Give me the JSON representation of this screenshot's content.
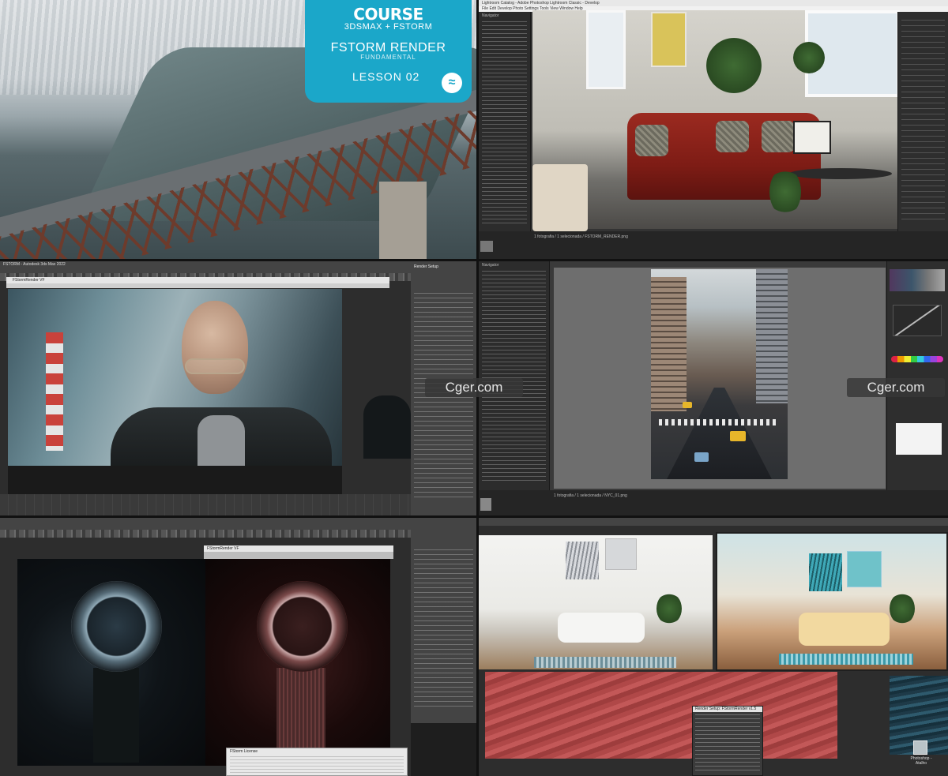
{
  "course_card": {
    "title": "COURSE",
    "subtitle": "3DSMAX + FSTORM",
    "name": "FSTORM RENDER",
    "tagline": "FUNDAMENTAL",
    "lesson": "LESSON 02"
  },
  "watermark": "Cger.com",
  "lightroom_top": {
    "title": "Lightroom Catalog - Adobe Photoshop Lightroom Classic - Develop",
    "menu": "File  Edit  Develop  Photo  Settings  Tools  View  Window  Help",
    "status": "1 fotografia / 1 selecionada / FSTORM_RENDER.png",
    "left_panel_label": "Navigator"
  },
  "max_middle": {
    "title": "FSTORM - Autodesk 3ds Max 2022",
    "framebuffer_title": "FStormRender VF",
    "render_setup_label": "Render Setup"
  },
  "lightroom_middle": {
    "status": "1 fotografia / 1 selecionada / NYC_01.png",
    "left_panel_label": "Navigator"
  },
  "max_bottom": {
    "framebuffer_title": "FStormRender VF",
    "license_title": "FStorm License"
  },
  "interior_bottom": {
    "dialog_title": "Render Setup: FStormRender v1.5",
    "desktop_icon_label": "Photoshop - Atalho"
  }
}
